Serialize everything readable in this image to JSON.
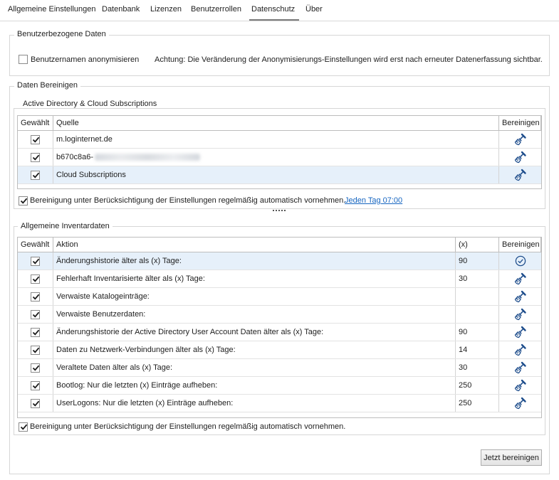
{
  "tabs": [
    {
      "label": "Allgemeine Einstellungen",
      "active": false
    },
    {
      "label": "Datenbank",
      "active": false
    },
    {
      "label": "Lizenzen",
      "active": false
    },
    {
      "label": "Benutzerrollen",
      "active": false
    },
    {
      "label": "Datenschutz",
      "active": true
    },
    {
      "label": "Über",
      "active": false
    }
  ],
  "user_data": {
    "title": "Benutzerbezogene Daten",
    "anonymize_label": "Benutzernamen anonymisieren",
    "anonymize_checked": false,
    "warning": "Achtung: Die Veränderung der Anonymisierungs-Einstellungen wird erst nach erneuter Datenerfassung sichtbar."
  },
  "cleanup": {
    "title": "Daten Bereinigen",
    "ad": {
      "title": "Active Directory & Cloud Subscriptions",
      "headers": {
        "selected": "Gewählt",
        "source": "Quelle",
        "clean": "Bereinigen"
      },
      "rows": [
        {
          "checked": true,
          "source": "m.loginternet.de",
          "selected": false
        },
        {
          "checked": true,
          "source": "b670c8a6-",
          "selected": false
        },
        {
          "checked": true,
          "source": "Cloud Subscriptions",
          "selected": true
        }
      ],
      "auto_label": "Bereinigung unter Berücksichtigung der Einstellungen regelmäßig automatisch vornehmen.",
      "auto_checked": true,
      "schedule_link": "Jeden Tag  07:00"
    },
    "inventory": {
      "title": "Allgemeine Inventardaten",
      "headers": {
        "selected": "Gewählt",
        "action": "Aktion",
        "x": "(x)",
        "clean": "Bereinigen"
      },
      "rows": [
        {
          "checked": true,
          "action": "Änderungshistorie älter als (x) Tage:",
          "x": "90",
          "selected": true,
          "done": true
        },
        {
          "checked": true,
          "action": "Fehlerhaft Inventarisierte älter als (x) Tage:",
          "x": "30",
          "selected": false,
          "done": false
        },
        {
          "checked": true,
          "action": "Verwaiste Katalogeinträge:",
          "x": "",
          "selected": false,
          "done": false
        },
        {
          "checked": true,
          "action": "Verwaiste Benutzerdaten:",
          "x": "",
          "selected": false,
          "done": false
        },
        {
          "checked": true,
          "action": "Änderungshistorie der Active Directory User Account Daten älter als (x) Tage:",
          "x": "90",
          "selected": false,
          "done": false
        },
        {
          "checked": true,
          "action": "Daten zu Netzwerk-Verbindungen älter als (x) Tage:",
          "x": "14",
          "selected": false,
          "done": false
        },
        {
          "checked": true,
          "action": "Veraltete Daten älter als (x) Tage:",
          "x": "30",
          "selected": false,
          "done": false
        },
        {
          "checked": true,
          "action": "Bootlog: Nur die letzten (x) Einträge aufheben:",
          "x": "250",
          "selected": false,
          "done": false
        },
        {
          "checked": true,
          "action": "UserLogons: Nur die letzten (x) Einträge aufheben:",
          "x": "250",
          "selected": false,
          "done": false
        }
      ],
      "auto_label": "Bereinigung unter Berücksichtigung der Einstellungen regelmäßig automatisch vornehmen.",
      "auto_checked": true
    },
    "clean_now_label": "Jetzt bereinigen"
  },
  "icons": {
    "broom": "broom-icon",
    "done": "check-circle-icon",
    "check": "checkmark-icon"
  },
  "colors": {
    "link": "#1565c0",
    "selected_row": "#e6f0fa",
    "icon": "#1f4e8c"
  }
}
